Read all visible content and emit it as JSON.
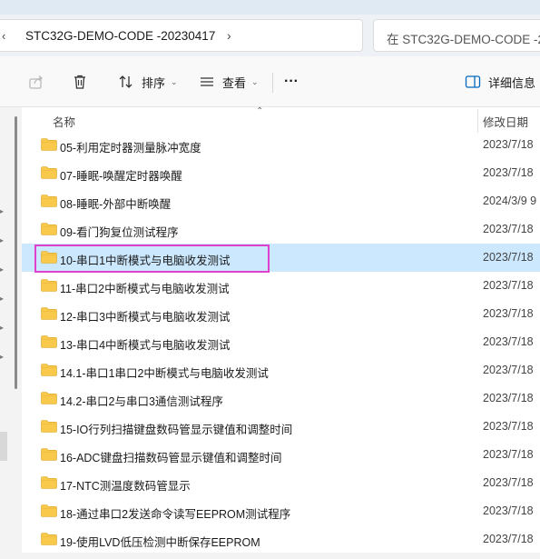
{
  "window": {
    "titlebar_color": "#dfeaf3"
  },
  "address": {
    "path": "STC32G-DEMO-CODE -20230417",
    "left_chevron": "‹",
    "right_chevron": "›"
  },
  "search": {
    "placeholder": "在 STC32G-DEMO-CODE -2"
  },
  "toolbar": {
    "share_icon": "share-icon",
    "delete_icon": "trash-icon",
    "sort_label": "排序",
    "view_label": "查看",
    "more_label": "···",
    "details_label": "详细信息"
  },
  "list": {
    "columns": {
      "name": "名称",
      "date": "修改日期"
    },
    "selected_index": 4,
    "highlight_color": "#e040d0",
    "selection_color": "#cce8ff",
    "folder_color": "#f8c94a",
    "rows": [
      {
        "name": "05-利用定时器测量脉冲宽度",
        "date": "2023/7/18"
      },
      {
        "name": "07-睡眠-唤醒定时器唤醒",
        "date": "2023/7/18"
      },
      {
        "name": "08-睡眠-外部中断唤醒",
        "date": "2024/3/9 9"
      },
      {
        "name": "09-看门狗复位测试程序",
        "date": "2023/7/18"
      },
      {
        "name": "10-串口1中断模式与电脑收发测试",
        "date": "2023/7/18"
      },
      {
        "name": "11-串口2中断模式与电脑收发测试",
        "date": "2023/7/18"
      },
      {
        "name": "12-串口3中断模式与电脑收发测试",
        "date": "2023/7/18"
      },
      {
        "name": "13-串口4中断模式与电脑收发测试",
        "date": "2023/7/18"
      },
      {
        "name": "14.1-串口1串口2中断模式与电脑收发测试",
        "date": "2023/7/18"
      },
      {
        "name": "14.2-串口2与串口3通信测试程序",
        "date": "2023/7/18"
      },
      {
        "name": "15-IO行列扫描键盘数码管显示键值和调整时间",
        "date": "2023/7/18"
      },
      {
        "name": "16-ADC键盘扫描数码管显示键值和调整时间",
        "date": "2023/7/18"
      },
      {
        "name": "17-NTC测温度数码管显示",
        "date": "2023/7/18"
      },
      {
        "name": "18-通过串口2发送命令读写EEPROM测试程序",
        "date": "2023/7/18"
      },
      {
        "name": "19-使用LVD低压检测中断保存EEPROM",
        "date": "2023/7/18"
      }
    ]
  }
}
